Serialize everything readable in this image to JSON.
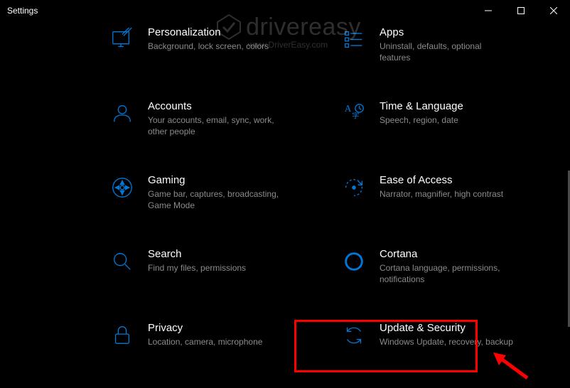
{
  "window": {
    "title": "Settings"
  },
  "watermark": {
    "brand": "drivereasy",
    "url": "www.DriverEasy.com"
  },
  "tiles": {
    "personalization": {
      "name": "Personalization",
      "desc": "Background, lock screen, colors"
    },
    "apps": {
      "name": "Apps",
      "desc": "Uninstall, defaults, optional features"
    },
    "accounts": {
      "name": "Accounts",
      "desc": "Your accounts, email, sync, work, other people"
    },
    "time": {
      "name": "Time & Language",
      "desc": "Speech, region, date"
    },
    "gaming": {
      "name": "Gaming",
      "desc": "Game bar, captures, broadcasting, Game Mode"
    },
    "ease": {
      "name": "Ease of Access",
      "desc": "Narrator, magnifier, high contrast"
    },
    "search": {
      "name": "Search",
      "desc": "Find my files, permissions"
    },
    "cortana": {
      "name": "Cortana",
      "desc": "Cortana language, permissions, notifications"
    },
    "privacy": {
      "name": "Privacy",
      "desc": "Location, camera, microphone"
    },
    "update": {
      "name": "Update & Security",
      "desc": "Windows Update, recovery, backup"
    }
  }
}
